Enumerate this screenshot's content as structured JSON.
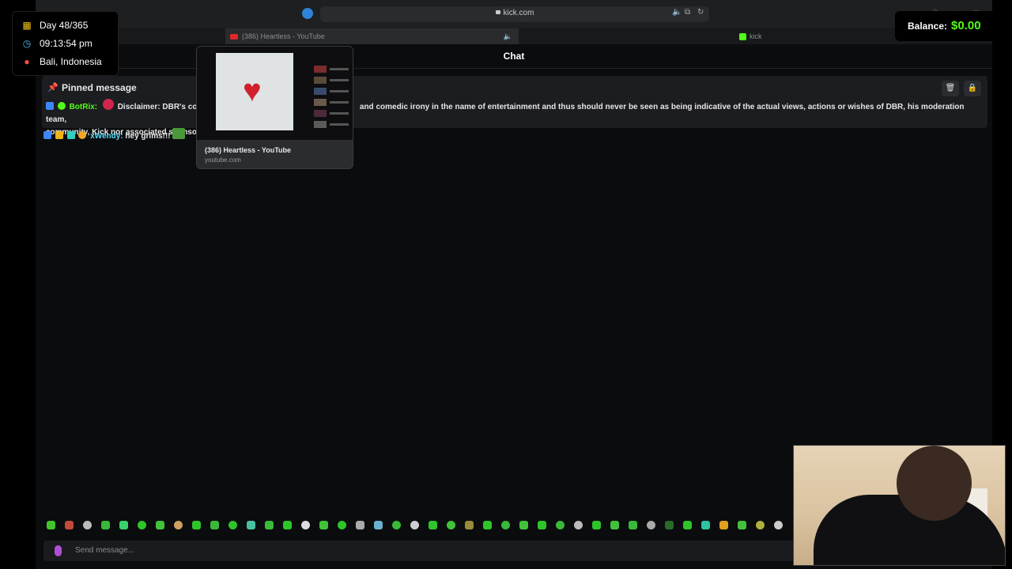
{
  "overlay": {
    "day": "Day 48/365",
    "time": "09:13:54 pm",
    "location": "Bali, Indonesia",
    "balance_label": "Balance:",
    "balance_value": "$0.00"
  },
  "browser": {
    "url": "kick.com",
    "tabs": [
      {
        "label": "(386) Heartless - YouTube",
        "icon": "youtube-icon"
      },
      {
        "label": "kick",
        "icon": "kick-icon"
      }
    ]
  },
  "tab_preview": {
    "title": "(386) Heartless - YouTube",
    "domain": "youtube.com"
  },
  "chat": {
    "header": "Chat",
    "pinned_title": "Pinned message",
    "pinned_user": "BotRix:",
    "pinned_text_start": "Disclaimer: DBR's cor",
    "pinned_text_mid": "and comedic irony in the name of entertainment and thus should never be seen as being indicative of the actual views, actions or wishes of DBR, his moderation team,",
    "pinned_text_line2": "community, Kick nor associated sponso",
    "message_user": "xWendy:",
    "message_text": "hey grims!!!",
    "input_placeholder": "Send message..."
  },
  "colors": {
    "kick_green": "#53fc18",
    "background": "#0b0c0e"
  }
}
